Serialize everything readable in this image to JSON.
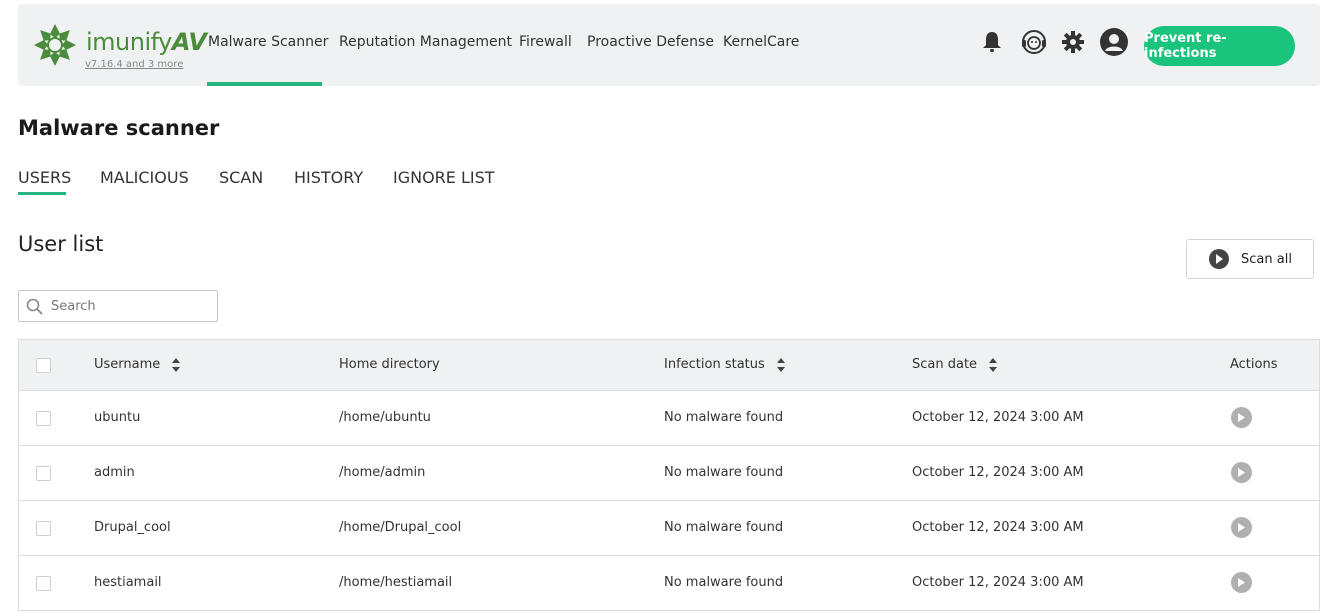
{
  "header": {
    "brand_prefix": "imunify",
    "brand_suffix": "AV",
    "version": "v7.16.4 and 3 more",
    "nav": [
      {
        "label": "Malware Scanner",
        "active": true
      },
      {
        "label": "Reputation Management",
        "active": false
      },
      {
        "label": "Firewall",
        "active": false
      },
      {
        "label": "Proactive Defense",
        "active": false
      },
      {
        "label": "KernelCare",
        "active": false
      }
    ],
    "icons": [
      "bell-icon",
      "support-agent-icon",
      "gear-icon",
      "user-avatar-icon"
    ],
    "cta_label": "Prevent re-infections",
    "accent_color": "#1bc47d"
  },
  "page": {
    "title": "Malware scanner",
    "tabs": [
      {
        "label": "USERS",
        "active": true
      },
      {
        "label": "MALICIOUS",
        "active": false
      },
      {
        "label": "SCAN",
        "active": false
      },
      {
        "label": "HISTORY",
        "active": false
      },
      {
        "label": "IGNORE LIST",
        "active": false
      }
    ]
  },
  "user_list": {
    "title": "User list",
    "scan_all_label": "Scan all",
    "search_placeholder": "Search",
    "columns": [
      "Username",
      "Home directory",
      "Infection status",
      "Scan date",
      "Actions"
    ],
    "rows": [
      {
        "username": "ubuntu",
        "home": "/home/ubuntu",
        "status": "No malware found",
        "date": "October 12, 2024 3:00 AM"
      },
      {
        "username": "admin",
        "home": "/home/admin",
        "status": "No malware found",
        "date": "October 12, 2024 3:00 AM"
      },
      {
        "username": "Drupal_cool",
        "home": "/home/Drupal_cool",
        "status": "No malware found",
        "date": "October 12, 2024 3:00 AM"
      },
      {
        "username": "hestiamail",
        "home": "/home/hestiamail",
        "status": "No malware found",
        "date": "October 12, 2024 3:00 AM"
      }
    ]
  }
}
